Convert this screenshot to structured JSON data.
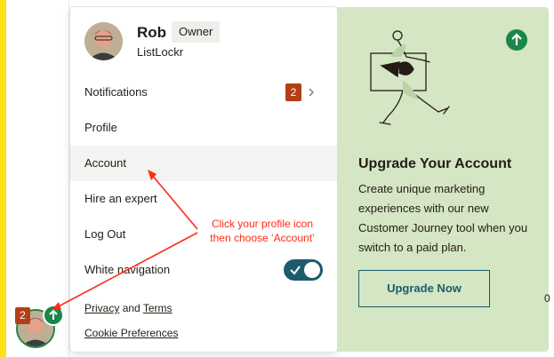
{
  "user": {
    "name": "Rob",
    "role": "Owner",
    "org": "ListLockr"
  },
  "menu": {
    "notifications": {
      "label": "Notifications",
      "count": "2"
    },
    "items": [
      "Profile",
      "Account",
      "Hire an expert",
      "Log Out"
    ],
    "white_navigation": {
      "label": "White navigation",
      "enabled": true
    }
  },
  "footer": {
    "privacy": "Privacy",
    "and": "and",
    "terms": "Terms",
    "cookie": "Cookie Preferences"
  },
  "upgrade": {
    "title": "Upgrade Your Account",
    "description": "Create unique marketing experiences with our new Customer Journey tool when you switch to a paid plan.",
    "button": "Upgrade Now"
  },
  "sidebar": {
    "notification_badge": "2"
  },
  "annotation": {
    "line1": "Click your profile icon",
    "line2": "then choose ‘Account’"
  },
  "edge_text": "0",
  "colors": {
    "accent_yellow": "#ffe01b",
    "teal": "#1d5b6c",
    "badge_red": "#b43e17",
    "green": "#1a8748",
    "upgrade_bg": "#d4e6c4",
    "annotation_red": "#ff2a14"
  }
}
